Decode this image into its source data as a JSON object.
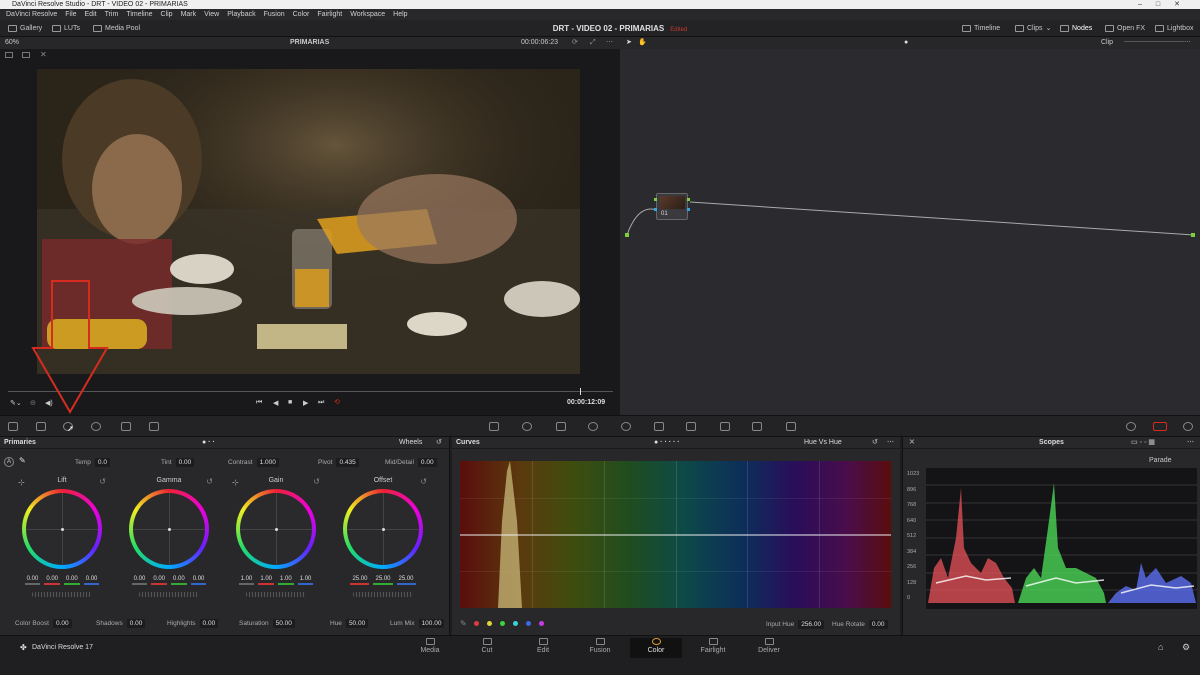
{
  "app": {
    "window_title": "DaVinci Resolve Studio - DRT - VIDEO 02 - PRIMARIAS",
    "project_title": "DRT - VIDEO 02 - PRIMARIAS",
    "edited": "Edited"
  },
  "menu": [
    "DaVinci Resolve",
    "File",
    "Edit",
    "Trim",
    "Timeline",
    "Clip",
    "Mark",
    "View",
    "Playback",
    "Fusion",
    "Color",
    "Fairlight",
    "Workspace",
    "Help"
  ],
  "toolbar": {
    "gallery": "Gallery",
    "luts": "LUTs",
    "media_pool": "Media Pool",
    "timeline": "Timeline",
    "clips": "Clips",
    "nodes": "Nodes",
    "open_fx": "Open FX",
    "lightbox": "Lightbox"
  },
  "viewer": {
    "zoom": "60%",
    "clip_name": "PRIMARIAS",
    "timecode_top": "00:00:06:23",
    "timecode_bottom": "00:00:12:09"
  },
  "node_editor": {
    "mode": "Clip",
    "node_label": "01"
  },
  "primaries": {
    "title": "Primaries",
    "mode": "Wheels",
    "temp_label": "Temp",
    "temp": "0.0",
    "tint_label": "Tint",
    "tint": "0.00",
    "contrast_label": "Contrast",
    "contrast": "1.000",
    "pivot_label": "Pivot",
    "pivot": "0.435",
    "middetail_label": "Mid/Detail",
    "middetail": "0.00",
    "wheels": [
      {
        "name": "Lift",
        "values": [
          "0.00",
          "0.00",
          "0.00",
          "0.00"
        ]
      },
      {
        "name": "Gamma",
        "values": [
          "0.00",
          "0.00",
          "0.00",
          "0.00"
        ]
      },
      {
        "name": "Gain",
        "values": [
          "1.00",
          "1.00",
          "1.00",
          "1.00"
        ]
      },
      {
        "name": "Offset",
        "values": [
          "25.00",
          "25.00",
          "25.00"
        ]
      }
    ],
    "colorboost_label": "Color Boost",
    "colorboost": "0.00",
    "shadows_label": "Shadows",
    "shadows": "0.00",
    "highlights_label": "Highlights",
    "highlights": "0.00",
    "saturation_label": "Saturation",
    "saturation": "50.00",
    "hue_label": "Hue",
    "hue": "50.00",
    "lummix_label": "Lum Mix",
    "lummix": "100.00"
  },
  "curves": {
    "title": "Curves",
    "mode": "Hue Vs Hue",
    "input_hue_label": "Input Hue",
    "input_hue": "256.00",
    "hue_rotate_label": "Hue Rotate",
    "hue_rotate": "0.00",
    "dot_colors": [
      "#e23b3b",
      "#e2d43b",
      "#3bd43b",
      "#3bd4d4",
      "#3b6ae2",
      "#c83be2"
    ]
  },
  "scopes": {
    "title": "Scopes",
    "mode": "Parade",
    "ticks": [
      "1023",
      "896",
      "768",
      "640",
      "512",
      "384",
      "256",
      "128",
      "0"
    ]
  },
  "pages": [
    "Media",
    "Cut",
    "Edit",
    "Fusion",
    "Color",
    "Fairlight",
    "Deliver"
  ],
  "active_page": "Color",
  "brand": "DaVinci Resolve 17",
  "colors": {
    "accent_red": "#d62c1f",
    "active_page_bg": "#111111"
  }
}
